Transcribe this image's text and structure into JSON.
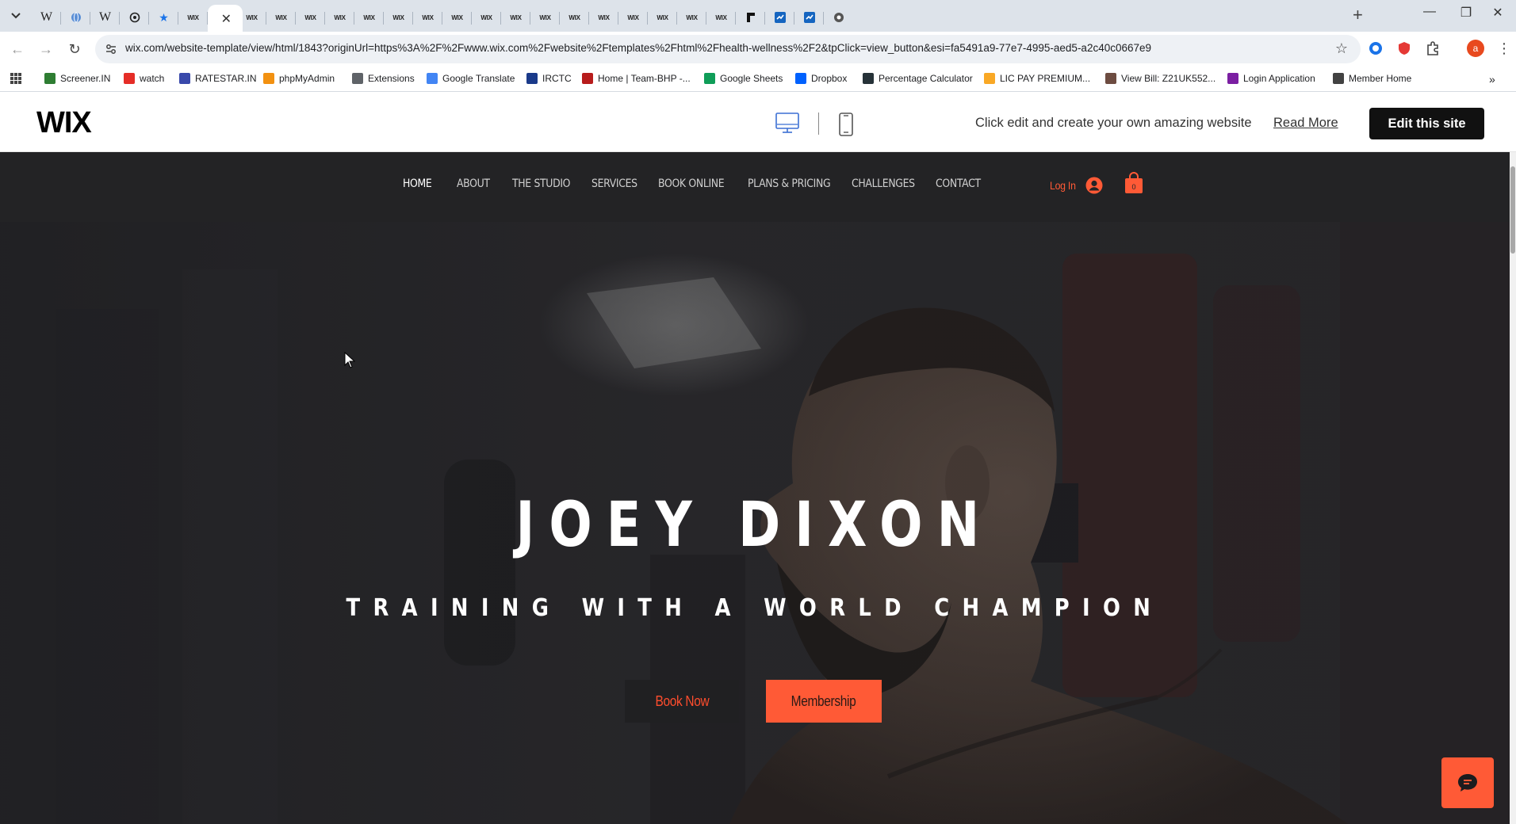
{
  "browser": {
    "tabs": [
      {
        "icon": "chevron-down-icon"
      },
      {
        "icon": "wikipedia-icon",
        "glyph": "W"
      },
      {
        "icon": "globe-icon"
      },
      {
        "icon": "wikipedia-icon",
        "glyph": "W"
      },
      {
        "icon": "openai-icon"
      },
      {
        "icon": "star-icon"
      },
      {
        "icon": "wix-icon",
        "glyph": "WIX"
      },
      {
        "icon": "wix-icon",
        "glyph": "WIX",
        "active": true
      }
    ],
    "wix_tab_glyph": "WIX",
    "wiki_glyph": "W",
    "url": "wix.com/website-template/view/html/1843?originUrl=https%3A%2F%2Fwww.wix.com%2Fwebsite%2Ftemplates%2Fhtml%2Fhealth-wellness%2F2&tpClick=view_button&esi=fa5491a9-77e7-4995-aed5-a2c40c0667e9",
    "profile_initial": "a"
  },
  "bookmarks": [
    {
      "label": "Screener.IN",
      "color": "#2e7d32"
    },
    {
      "label": "watch",
      "color": "#e52d27"
    },
    {
      "label": "RATESTAR.IN",
      "color": "#3949ab"
    },
    {
      "label": "phpMyAdmin",
      "color": "#f29111"
    },
    {
      "label": "Extensions",
      "color": "#5f6368"
    },
    {
      "label": "Google Translate",
      "color": "#4285f4"
    },
    {
      "label": "IRCTC",
      "color": "#1a3a8a"
    },
    {
      "label": "Home | Team-BHP -...",
      "color": "#b71c1c"
    },
    {
      "label": "Google Sheets",
      "color": "#0f9d58"
    },
    {
      "label": "Dropbox",
      "color": "#0061fe"
    },
    {
      "label": "Percentage Calculator",
      "color": "#263238"
    },
    {
      "label": "LIC PAY PREMIUM...",
      "color": "#f9a825"
    },
    {
      "label": "View Bill: Z21UK552...",
      "color": "#6d4c41"
    },
    {
      "label": "Login Application",
      "color": "#7b1fa2"
    },
    {
      "label": "Member Home",
      "color": "#424242"
    }
  ],
  "wix_header": {
    "logo": "WIX",
    "edit_text": "Click edit and create your own amazing website",
    "read_more": "Read More",
    "edit_button": "Edit this site"
  },
  "site": {
    "nav": [
      "HOME",
      "ABOUT",
      "THE STUDIO",
      "SERVICES",
      "BOOK ONLINE",
      "PLANS & PRICING",
      "CHALLENGES",
      "CONTACT"
    ],
    "active_nav": "HOME",
    "login": "Log In",
    "cart_count": "0",
    "hero_title": "JOEY DIXON",
    "hero_subtitle": "TRAINING WITH A WORLD CHAMPION",
    "book_now": "Book Now",
    "membership": "Membership",
    "accent_color": "#ff5a36"
  }
}
